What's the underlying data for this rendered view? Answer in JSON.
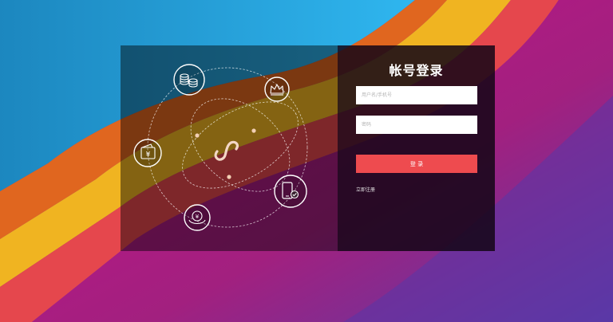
{
  "login": {
    "title": "帐号登录",
    "username_placeholder": "用户名/手机号",
    "password_placeholder": "密码",
    "submit_label": "登 录",
    "register_link": "立即注册"
  },
  "illustration": {
    "center_icon": "mini-program-logo-icon",
    "icons": [
      "coins-icon",
      "crown-icon",
      "wallet-icon",
      "phone-check-icon",
      "yuan-coin-icon"
    ],
    "yuan_symbol": "¥"
  },
  "colors": {
    "accent_button": "#ee4b4f",
    "form_panel": "#140616",
    "text_white": "#ffffff"
  }
}
